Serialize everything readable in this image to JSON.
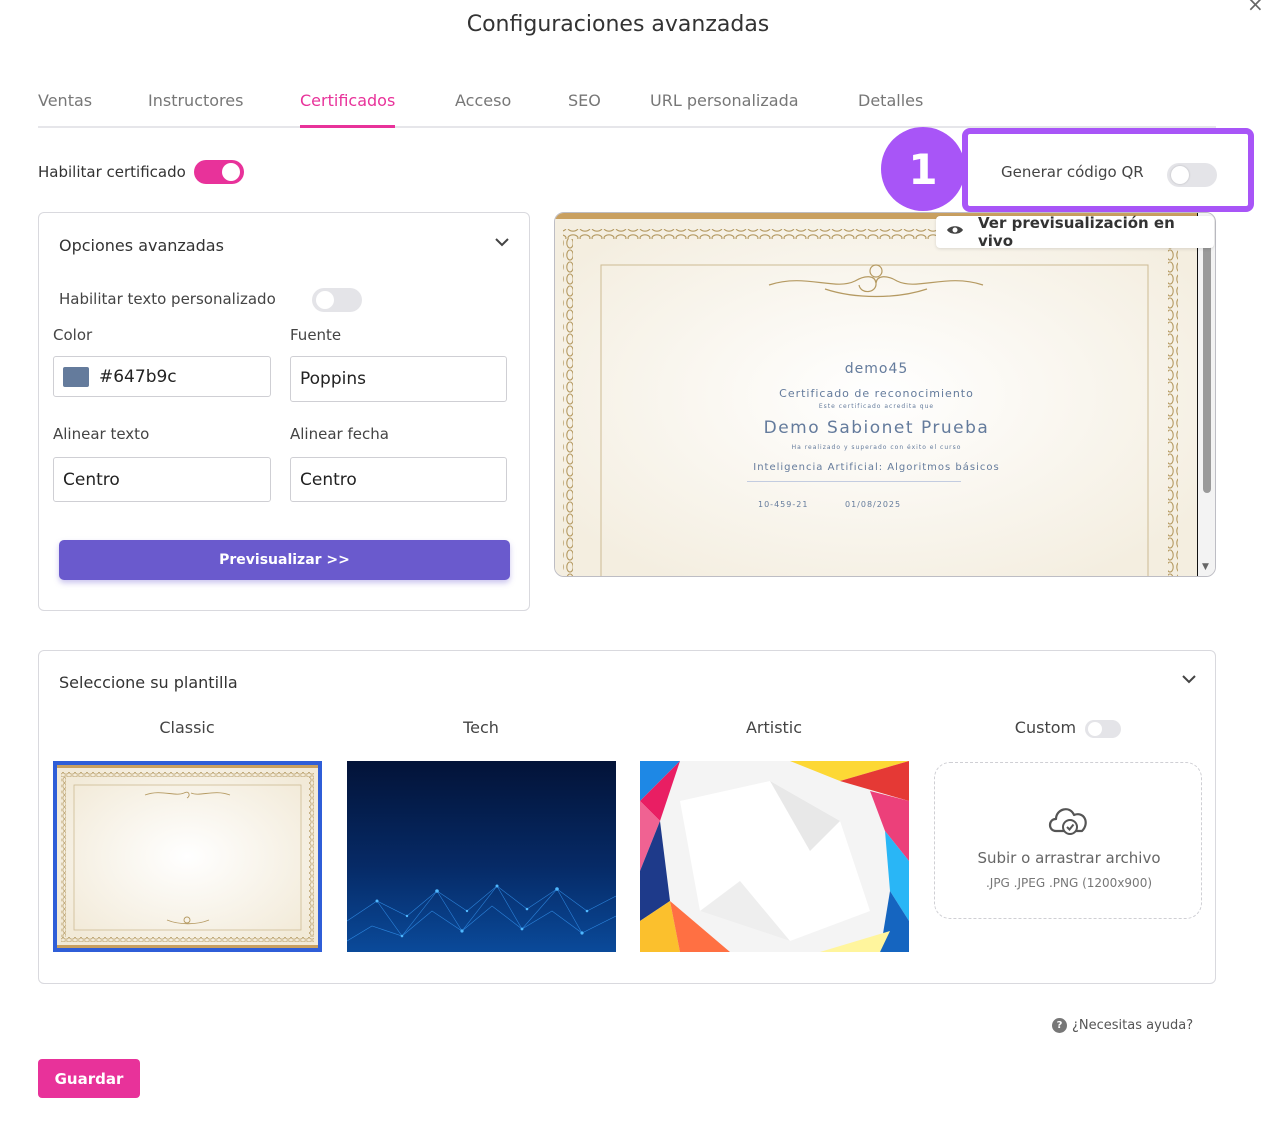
{
  "dialog": {
    "title": "Configuraciones avanzadas",
    "close_icon": "×"
  },
  "tabs": [
    {
      "label": "Ventas"
    },
    {
      "label": "Instructores"
    },
    {
      "label": "Certificados",
      "active": true
    },
    {
      "label": "Acceso"
    },
    {
      "label": "SEO"
    },
    {
      "label": "URL personalizada"
    },
    {
      "label": "Detalles"
    }
  ],
  "certificate": {
    "enable_label": "Habilitar certificado",
    "enabled": true,
    "qr_label": "Generar código QR",
    "qr_enabled": false,
    "step_badge": "1"
  },
  "advanced": {
    "title": "Opciones avanzadas",
    "custom_text_label": "Habilitar texto personalizado",
    "custom_text_enabled": false,
    "color_label": "Color",
    "color_value": "#647b9c",
    "font_label": "Fuente",
    "font_value": "Poppins",
    "align_text_label": "Alinear texto",
    "align_text_value": "Centro",
    "align_date_label": "Alinear fecha",
    "align_date_value": "Centro",
    "preview_button": "Previsualizar >>"
  },
  "preview": {
    "live_button": "Ver previsualización en vivo",
    "cert": {
      "org": "demo45",
      "heading": "Certificado de reconocimiento",
      "accredits": "Este certificado acredita que",
      "name": "Demo Sabionet Prueba",
      "completed": "Ha realizado y superado con éxito el curso",
      "course": "Inteligencia Artificial: Algoritmos básicos",
      "code": "10-459-21",
      "date": "01/08/2025"
    }
  },
  "templates": {
    "title": "Seleccione su plantilla",
    "items": [
      {
        "name": "Classic",
        "selected": true
      },
      {
        "name": "Tech"
      },
      {
        "name": "Artistic"
      },
      {
        "name": "Custom",
        "enabled": false
      }
    ],
    "upload_text": "Subir o arrastrar archivo",
    "upload_formats": ".JPG .JPEG .PNG (1200x900)"
  },
  "help_text": "¿Necesitas ayuda?",
  "save_button": "Guardar",
  "colors": {
    "accent": "#e8329a",
    "primary_button": "#6a5acd",
    "highlight": "#a855f7",
    "selected_border": "#2f5ed8"
  }
}
